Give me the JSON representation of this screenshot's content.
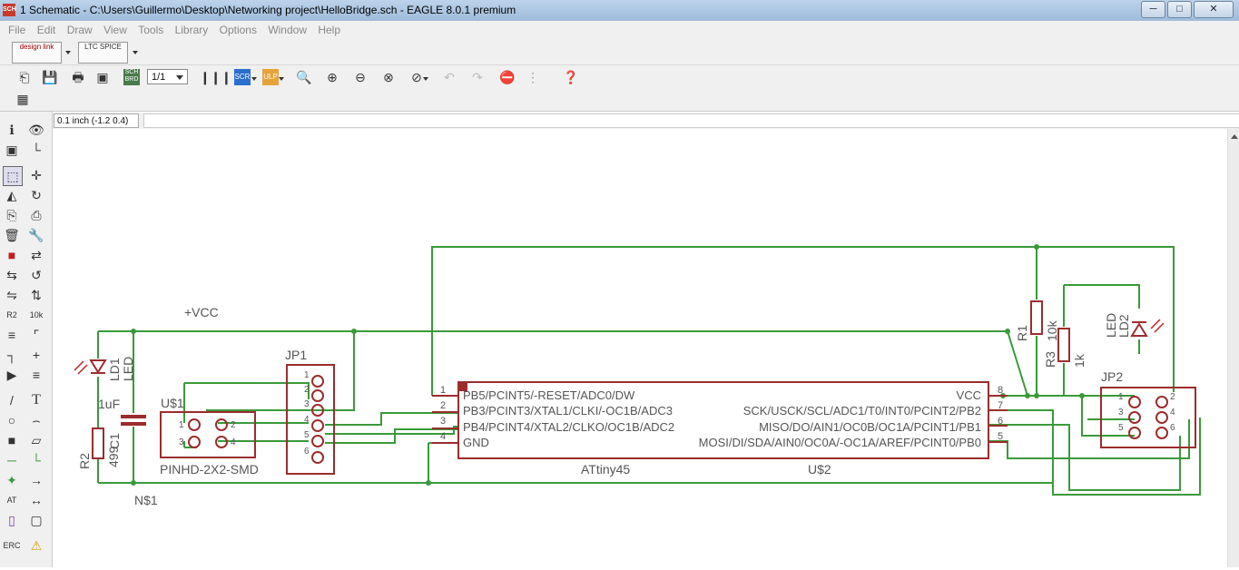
{
  "window": {
    "icon": "SCH",
    "title": "1 Schematic - C:\\Users\\Guillermo\\Desktop\\Networking project\\HelloBridge.sch - EAGLE 8.0.1 premium",
    "minimize": "─",
    "maximize": "□",
    "close": "✕"
  },
  "menu": [
    "File",
    "Edit",
    "Draw",
    "View",
    "Tools",
    "Library",
    "Options",
    "Window",
    "Help"
  ],
  "toolbar1": {
    "designlink": "design link",
    "ltspice": "LTC SPICE"
  },
  "toolbar2": {
    "sheet": "1/1",
    "sch_label": "SCH BRD",
    "scr_label": "SCR",
    "ulp_label": "ULP"
  },
  "coord": "0.1 inch (-1.2 0.4)",
  "left_tools": [
    {
      "name": "info-icon",
      "glyph": "ℹ"
    },
    {
      "name": "show-icon",
      "glyph": "👁"
    },
    {
      "name": "layers-icon",
      "glyph": "▣"
    },
    {
      "name": "mark-icon",
      "glyph": "└"
    },
    {
      "name": "select-icon",
      "glyph": "⬚"
    },
    {
      "name": "move-icon",
      "glyph": "✛"
    },
    {
      "name": "mirror-icon",
      "glyph": "◭"
    },
    {
      "name": "rotate-icon",
      "glyph": "↻"
    },
    {
      "name": "copy-icon",
      "glyph": "⎘"
    },
    {
      "name": "paste-icon",
      "glyph": "⎙"
    },
    {
      "name": "delete-icon",
      "glyph": "🗑"
    },
    {
      "name": "wrench-icon",
      "glyph": "🔧"
    },
    {
      "name": "add-part-icon",
      "glyph": "■"
    },
    {
      "name": "replace-icon",
      "glyph": "⇄"
    },
    {
      "name": "split-icon",
      "glyph": "⇆"
    },
    {
      "name": "invoke-icon",
      "glyph": "↺"
    },
    {
      "name": "gate-swap-icon",
      "glyph": "⇋"
    },
    {
      "name": "pin-swap-icon",
      "glyph": "⇅"
    },
    {
      "name": "name-icon",
      "glyph": "R2"
    },
    {
      "name": "value-icon",
      "glyph": "10k"
    },
    {
      "name": "smash-icon",
      "glyph": "≡"
    },
    {
      "name": "miter-icon",
      "glyph": "⌜"
    },
    {
      "name": "split-wire-icon",
      "glyph": "┐"
    },
    {
      "name": "optimize-icon",
      "glyph": "+"
    },
    {
      "name": "route-icon",
      "glyph": "▶"
    },
    {
      "name": "ripup-icon",
      "glyph": "≡"
    },
    {
      "name": "line-icon",
      "glyph": "/"
    },
    {
      "name": "text-icon",
      "glyph": "T"
    },
    {
      "name": "circle-icon",
      "glyph": "○"
    },
    {
      "name": "arc-icon",
      "glyph": "⌢"
    },
    {
      "name": "rect-icon",
      "glyph": "■"
    },
    {
      "name": "polygon-icon",
      "glyph": "▱"
    },
    {
      "name": "net-icon",
      "glyph": "─"
    },
    {
      "name": "bus-icon",
      "glyph": "└"
    },
    {
      "name": "junction-icon",
      "glyph": "✦"
    },
    {
      "name": "label-icon",
      "glyph": "→"
    },
    {
      "name": "attribute-icon",
      "glyph": "AT"
    },
    {
      "name": "dimension-icon",
      "glyph": "↔"
    },
    {
      "name": "frame-icon",
      "glyph": "▯"
    },
    {
      "name": "group-icon",
      "glyph": "▢"
    },
    {
      "name": "erc-icon",
      "glyph": "ERC"
    },
    {
      "name": "warning-icon",
      "glyph": "⚠"
    }
  ],
  "schematic": {
    "vcc_label": "+VCC",
    "n1_label": "N$1",
    "jp1_label": "JP1",
    "jp1_pins": [
      "1",
      "2",
      "3",
      "4",
      "5",
      "6"
    ],
    "u1_label": "U$1",
    "u1_pins": [
      "1",
      "3",
      "2",
      "4"
    ],
    "u1_package": "PINHD-2X2-SMD",
    "c1_name": "C1",
    "c1_value": "1uF",
    "r2_name": "R2",
    "r2_value": "499",
    "ld1_name": "LD1",
    "ld1_type": "LED",
    "attiny": {
      "name": "ATtiny45",
      "ref": "U$2",
      "left_pins": [
        {
          "num": "1",
          "label": "PB5/PCINT5/-RESET/ADC0/DW"
        },
        {
          "num": "2",
          "label": "PB3/PCINT3/XTAL1/CLKI/-OC1B/ADC3"
        },
        {
          "num": "3",
          "label": "PB4/PCINT4/XTAL2/CLKO/OC1B/ADC2"
        },
        {
          "num": "4",
          "label": "GND"
        }
      ],
      "right_pins": [
        {
          "num": "8",
          "label": "VCC"
        },
        {
          "num": "7",
          "label": "SCK/USCK/SCL/ADC1/T0/INT0/PCINT2/PB2"
        },
        {
          "num": "6",
          "label": "MISO/DO/AIN1/OC0B/OC1A/PCINT1/PB1"
        },
        {
          "num": "5",
          "label": "MOSI/DI/SDA/AIN0/OC0A/-OC1A/AREF/PCINT0/PB0"
        }
      ]
    },
    "r1_name": "R1",
    "r1_value": "10k",
    "r3_name": "R3",
    "r3_value": "1k",
    "ld2_name": "LD2",
    "ld2_type": "LED",
    "jp2_label": "JP2",
    "jp2_pins": [
      "1",
      "3",
      "5",
      "2",
      "4",
      "6"
    ]
  },
  "colors": {
    "net": "#3a9a3a",
    "part": "#9b2d2d",
    "text": "#555555"
  }
}
